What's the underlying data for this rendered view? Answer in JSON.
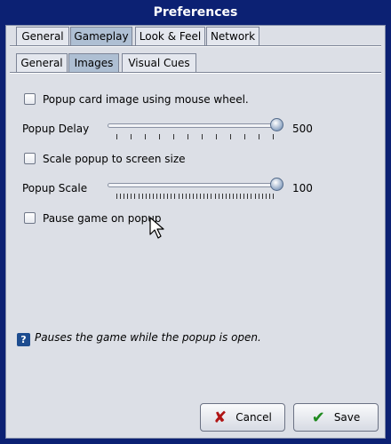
{
  "window": {
    "title": "Preferences"
  },
  "main_tabs": [
    {
      "label": "General",
      "active": false
    },
    {
      "label": "Gameplay",
      "active": true
    },
    {
      "label": "Look & Feel",
      "active": false
    },
    {
      "label": "Network",
      "active": false
    }
  ],
  "sub_tabs": [
    {
      "label": "General",
      "active": false
    },
    {
      "label": "Images",
      "active": true
    },
    {
      "label": "Visual Cues",
      "active": false
    }
  ],
  "options": {
    "mouse_wheel": {
      "label": "Popup card image using mouse wheel.",
      "checked": false
    },
    "popup_delay": {
      "label": "Popup Delay",
      "value": "500",
      "level": 1.0
    },
    "scale_popup": {
      "label": "Scale popup to screen size",
      "checked": false
    },
    "popup_scale": {
      "label": "Popup Scale",
      "value": "100",
      "level": 1.0
    },
    "pause_game": {
      "label": "Pause game on popup",
      "checked": false
    }
  },
  "hint": {
    "icon": "help-icon",
    "glyph": "?",
    "text": "Pauses the game while the popup is open."
  },
  "buttons": {
    "cancel": {
      "label": "Cancel",
      "icon": "red-x-icon",
      "glyph": "✘"
    },
    "save": {
      "label": "Save",
      "icon": "green-check-icon",
      "glyph": "✔"
    }
  },
  "colors": {
    "titlebar": "#0c2173",
    "panel": "#dcdfe6",
    "active_tab": "#aebfd3",
    "cancel_icon": "#b01515",
    "save_icon": "#1f8a1f"
  }
}
